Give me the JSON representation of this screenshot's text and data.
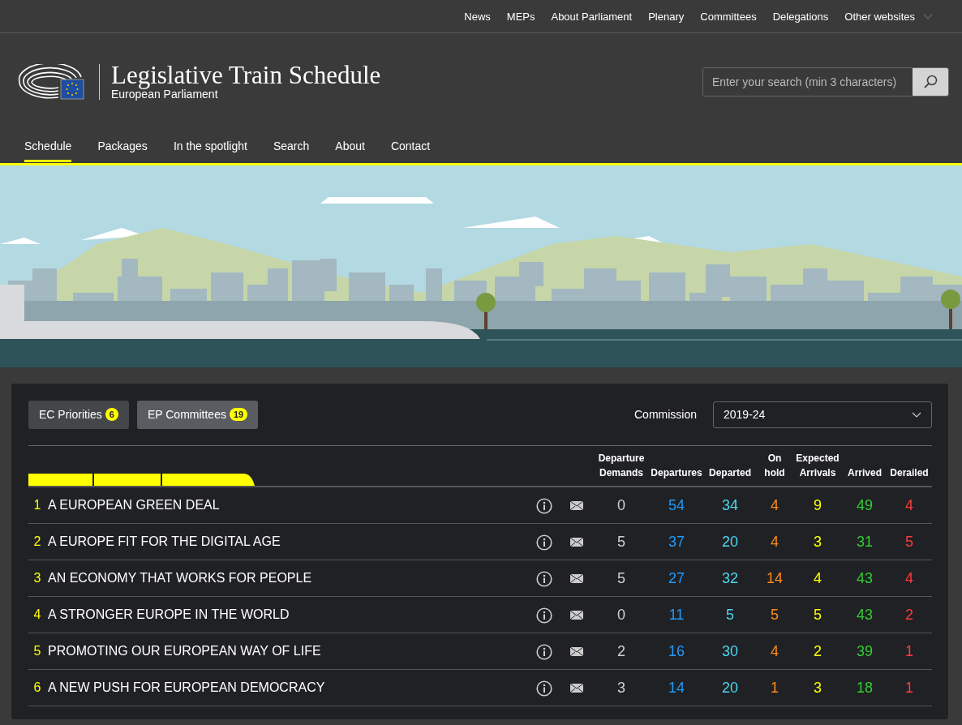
{
  "top_links": [
    {
      "label": "News"
    },
    {
      "label": "MEPs"
    },
    {
      "label": "About Parliament"
    },
    {
      "label": "Plenary"
    },
    {
      "label": "Committees"
    },
    {
      "label": "Delegations"
    },
    {
      "label": "Other websites",
      "dropdown": true
    }
  ],
  "site": {
    "title": "Legislative Train Schedule",
    "subtitle": "European Parliament"
  },
  "search": {
    "placeholder": "Enter your search (min 3 characters)"
  },
  "nav": [
    {
      "label": "Schedule",
      "selected": true
    },
    {
      "label": "Packages",
      "selected": false
    },
    {
      "label": "In the spotlight",
      "selected": false
    },
    {
      "label": "Search",
      "selected": false
    },
    {
      "label": "About",
      "selected": false
    },
    {
      "label": "Contact",
      "selected": false
    }
  ],
  "filters": [
    {
      "label": "EC Priorities",
      "count": "6",
      "selected": false
    },
    {
      "label": "EP Committees",
      "count": "19",
      "selected": true
    }
  ],
  "commission": {
    "label": "Commission",
    "value": "2019-24"
  },
  "columns": [
    {
      "label": "Departure Demands",
      "color": "#d0d0d0"
    },
    {
      "label": "Departures",
      "color": "#1e9bff"
    },
    {
      "label": "Departed",
      "color": "#4fd6f0"
    },
    {
      "label": "On hold",
      "color": "#ff8c1a"
    },
    {
      "label": "Expected Arrivals",
      "color": "#ffff00"
    },
    {
      "label": "Arrived",
      "color": "#33cc33"
    },
    {
      "label": "Derailed",
      "color": "#ff3b3b"
    }
  ],
  "rows": [
    {
      "number": "1",
      "title": "A EUROPEAN GREEN DEAL",
      "values": [
        "0",
        "54",
        "34",
        "4",
        "9",
        "49",
        "4"
      ]
    },
    {
      "number": "2",
      "title": "A EUROPE FIT FOR THE DIGITAL AGE",
      "values": [
        "5",
        "37",
        "20",
        "4",
        "3",
        "31",
        "5"
      ]
    },
    {
      "number": "3",
      "title": "AN ECONOMY THAT WORKS FOR PEOPLE",
      "values": [
        "5",
        "27",
        "32",
        "14",
        "4",
        "43",
        "4"
      ]
    },
    {
      "number": "4",
      "title": "A STRONGER EUROPE IN THE WORLD",
      "values": [
        "0",
        "11",
        "5",
        "5",
        "5",
        "43",
        "2"
      ]
    },
    {
      "number": "5",
      "title": "PROMOTING OUR EUROPEAN WAY OF LIFE",
      "values": [
        "2",
        "16",
        "30",
        "4",
        "2",
        "39",
        "1"
      ]
    },
    {
      "number": "6",
      "title": "A NEW PUSH FOR EUROPEAN DEMOCRACY",
      "values": [
        "3",
        "14",
        "20",
        "1",
        "3",
        "18",
        "1"
      ]
    }
  ]
}
